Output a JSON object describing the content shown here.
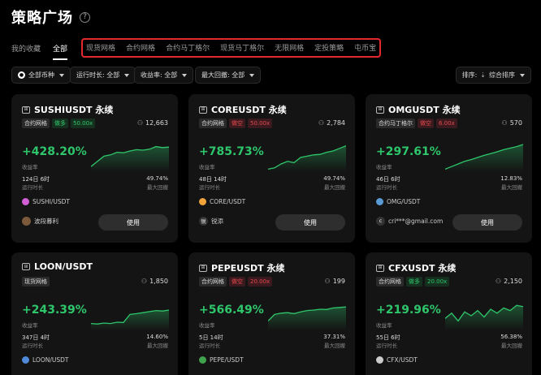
{
  "page": {
    "title": "策略广场",
    "help_icon": "?"
  },
  "tabs": {
    "mine": "我的收藏",
    "all": "全部",
    "highlighted": [
      "现货网格",
      "合约网格",
      "合约马丁格尔",
      "现货马丁格尔",
      "无限网格",
      "定投策略",
      "屯币宝"
    ]
  },
  "filters": {
    "coin": "全部币种",
    "runtime": "运行时长: 全部",
    "return": "收益率: 全部",
    "drawdown": "最大回撤: 全部",
    "sort_label": "排序:",
    "sort_value": "综合排序"
  },
  "labels": {
    "return": "收益率",
    "runtime": "运行时长",
    "max_drawdown": "最大回撤",
    "use": "使用"
  },
  "colors": {
    "green": "#2ec66b",
    "red": "#e5484d",
    "highlight": "#e5282e"
  },
  "cards": [
    {
      "title": "SUSHIUSDT 永续",
      "type": "合约网格",
      "direction": "做多",
      "direction_kind": "long",
      "leverage": "50.00x",
      "users": "12,663",
      "return": "+428.20%",
      "runtime": "124日 6时",
      "drawdown": "49.74%",
      "pair": "SUSHI/USDT",
      "creator": "波段暮利",
      "creator_avatar": "",
      "pair_color": "#d05fd6",
      "spark": [
        0.15,
        0.35,
        0.55,
        0.6,
        0.7,
        0.68,
        0.75,
        0.8,
        0.78,
        0.82,
        0.92,
        0.88,
        0.9
      ]
    },
    {
      "title": "COREUSDT 永续",
      "type": "合约网格",
      "direction": "做空",
      "direction_kind": "short",
      "leverage": "50.00x",
      "users": "2,784",
      "return": "+785.73%",
      "runtime": "48日 14时",
      "drawdown": "49.74%",
      "pair": "CORE/USDT",
      "creator": "锐添",
      "creator_avatar": "锐",
      "pair_color": "#f2a33a",
      "spark": [
        0.05,
        0.1,
        0.25,
        0.35,
        0.3,
        0.5,
        0.55,
        0.6,
        0.62,
        0.7,
        0.75,
        0.85,
        0.95
      ]
    },
    {
      "title": "OMGUSDT 永续",
      "type": "合约马丁格尔",
      "direction": "做空",
      "direction_kind": "short",
      "leverage": "6.00x",
      "users": "570",
      "return": "+297.61%",
      "runtime": "46日 6时",
      "drawdown": "12.83%",
      "pair": "OMG/USDT",
      "creator": "cri***@gmail.com",
      "creator_avatar": "c",
      "pair_color": "#5b9bd5",
      "spark": [
        0.05,
        0.15,
        0.25,
        0.35,
        0.42,
        0.5,
        0.58,
        0.65,
        0.72,
        0.8,
        0.86,
        0.92,
        1.0
      ]
    },
    {
      "title": "LOON/USDT",
      "type": "现货网格",
      "direction": "",
      "direction_kind": "none",
      "leverage": "",
      "users": "1,850",
      "return": "+243.39%",
      "runtime": "347日 4时",
      "drawdown": "14.60%",
      "pair": "LOON/USDT",
      "creator": "",
      "creator_avatar": "",
      "pair_color": "#4f8ad9",
      "spark": [
        0.2,
        0.18,
        0.22,
        0.2,
        0.25,
        0.24,
        0.55,
        0.58,
        0.62,
        0.66,
        0.7,
        0.68,
        0.72
      ]
    },
    {
      "title": "PEPEUSDT 永续",
      "type": "合约网格",
      "direction": "做空",
      "direction_kind": "short",
      "leverage": "20.00x",
      "users": "199",
      "return": "+566.49%",
      "runtime": "5日 14时",
      "drawdown": "37.31%",
      "pair": "PEPE/USDT",
      "creator": "",
      "creator_avatar": "",
      "pair_color": "#3fa34d",
      "spark": [
        0.3,
        0.55,
        0.6,
        0.62,
        0.58,
        0.65,
        0.7,
        0.72,
        0.75,
        0.74,
        0.8,
        0.82,
        0.84
      ]
    },
    {
      "title": "CFXUSDT 永续",
      "type": "合约网格",
      "direction": "做多",
      "direction_kind": "long",
      "leverage": "20.00x",
      "users": "2,150",
      "return": "+219.96%",
      "runtime": "55日 6时",
      "drawdown": "56.38%",
      "pair": "CFX/USDT",
      "creator": "",
      "creator_avatar": "",
      "pair_color": "#cccccc",
      "spark": [
        0.4,
        0.6,
        0.3,
        0.65,
        0.5,
        0.7,
        0.45,
        0.75,
        0.6,
        0.8,
        0.7,
        0.9,
        0.85
      ]
    }
  ]
}
